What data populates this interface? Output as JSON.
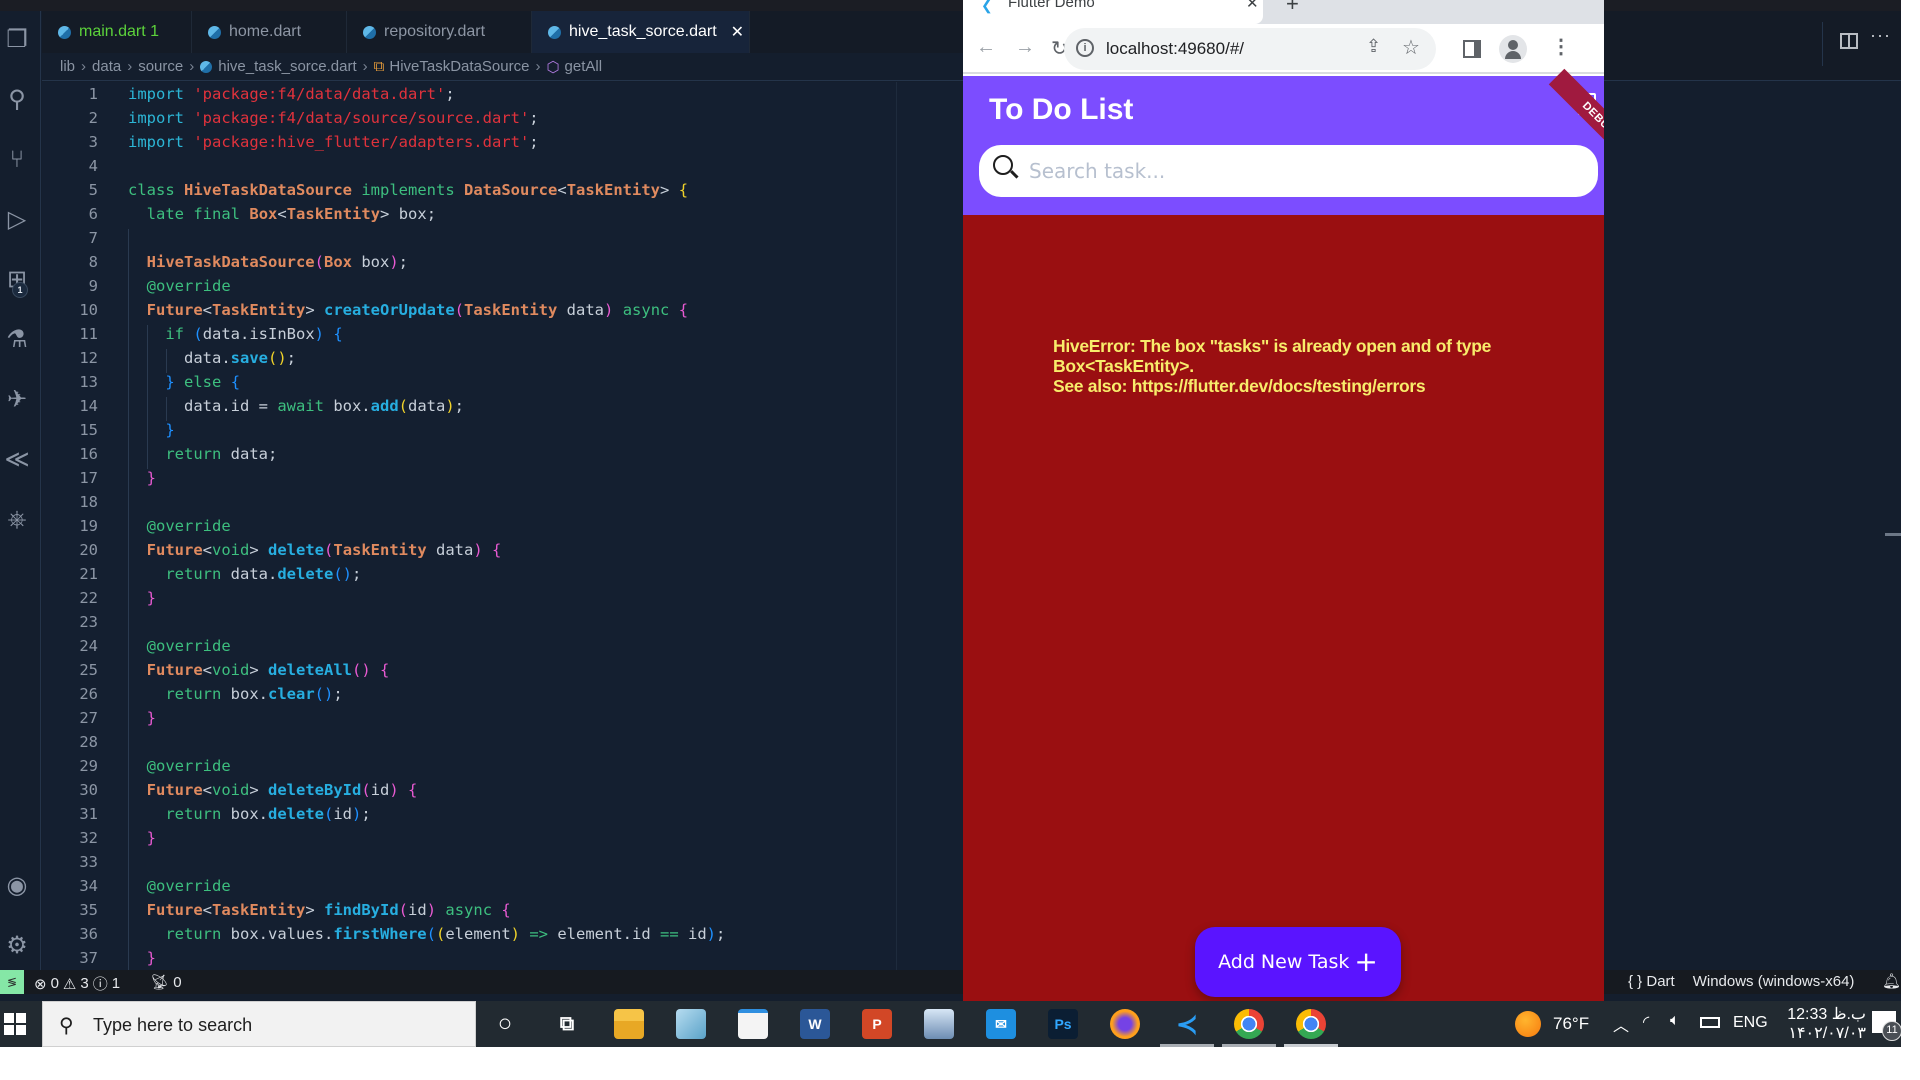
{
  "vscode": {
    "activity_bar": [
      {
        "name": "explorer-icon",
        "glyph": "❐"
      },
      {
        "name": "search-icon",
        "glyph": "⚲"
      },
      {
        "name": "source-control-icon",
        "glyph": "⑂"
      },
      {
        "name": "run-debug-icon",
        "glyph": "▷"
      },
      {
        "name": "extensions-icon",
        "glyph": "⊞",
        "badge": "1"
      },
      {
        "name": "testing-icon",
        "glyph": "⚗"
      },
      {
        "name": "pcc-extension-icon",
        "glyph": "✈"
      },
      {
        "name": "flutter-icon",
        "glyph": "≪"
      },
      {
        "name": "kubernetes-icon",
        "glyph": "⎈"
      },
      {
        "name": "accounts-icon",
        "glyph": "◉"
      },
      {
        "name": "settings-gear-icon",
        "glyph": "⚙"
      }
    ],
    "tabs": [
      {
        "label": "main.dart",
        "suffix": "1",
        "state": "warning"
      },
      {
        "label": "home.dart",
        "state": "normal"
      },
      {
        "label": "repository.dart",
        "state": "normal"
      },
      {
        "label": "hive_task_sorce.dart",
        "state": "active",
        "close": "✕"
      }
    ],
    "breadcrumbs": [
      "lib",
      "data",
      "source",
      "hive_task_sorce.dart",
      "HiveTaskDataSource",
      "getAll"
    ],
    "breadcrumb_separator": "›",
    "editor_actions": {
      "split": "split-editor",
      "more": "···"
    },
    "code_lines": [
      [
        [
          "imp",
          "import"
        ],
        [
          "pl",
          " "
        ],
        [
          "str",
          "'package:f4/data/data.dart'"
        ],
        [
          "pl",
          ";"
        ]
      ],
      [
        [
          "imp",
          "import"
        ],
        [
          "pl",
          " "
        ],
        [
          "str",
          "'package:f4/data/source/source.dart'"
        ],
        [
          "pl",
          ";"
        ]
      ],
      [
        [
          "imp",
          "import"
        ],
        [
          "pl",
          " "
        ],
        [
          "str",
          "'package:hive_flutter/adapters.dart'"
        ],
        [
          "pl",
          ";"
        ]
      ],
      [],
      [
        [
          "kw",
          "class"
        ],
        [
          "pl",
          " "
        ],
        [
          "typ",
          "HiveTaskDataSource"
        ],
        [
          "pl",
          " "
        ],
        [
          "kw",
          "implements"
        ],
        [
          "pl",
          " "
        ],
        [
          "typ",
          "DataSource"
        ],
        [
          "pl",
          "<"
        ],
        [
          "typ",
          "TaskEntity"
        ],
        [
          "pl",
          "> "
        ],
        [
          "p2",
          "{"
        ]
      ],
      [
        [
          "pl",
          "  "
        ],
        [
          "kw",
          "late"
        ],
        [
          "pl",
          " "
        ],
        [
          "kw",
          "final"
        ],
        [
          "pl",
          " "
        ],
        [
          "typ",
          "Box"
        ],
        [
          "pl",
          "<"
        ],
        [
          "typ",
          "TaskEntity"
        ],
        [
          "pl",
          "> box;"
        ]
      ],
      [],
      [
        [
          "pl",
          "  "
        ],
        [
          "typ",
          "HiveTaskDataSource"
        ],
        [
          "p1",
          "("
        ],
        [
          "typ",
          "Box"
        ],
        [
          "pl",
          " box"
        ],
        [
          "p1",
          ")"
        ],
        [
          "pl",
          ";"
        ]
      ],
      [
        [
          "pl",
          "  "
        ],
        [
          "ann",
          "@override"
        ]
      ],
      [
        [
          "pl",
          "  "
        ],
        [
          "typ",
          "Future"
        ],
        [
          "pl",
          "<"
        ],
        [
          "typ",
          "TaskEntity"
        ],
        [
          "pl",
          "> "
        ],
        [
          "fn",
          "createOrUpdate"
        ],
        [
          "p1",
          "("
        ],
        [
          "typ",
          "TaskEntity"
        ],
        [
          "pl",
          " data"
        ],
        [
          "p1",
          ")"
        ],
        [
          "pl",
          " "
        ],
        [
          "kw",
          "async"
        ],
        [
          "pl",
          " "
        ],
        [
          "p1",
          "{"
        ]
      ],
      [
        [
          "pl",
          "    "
        ],
        [
          "kw",
          "if"
        ],
        [
          "pl",
          " "
        ],
        [
          "p3",
          "("
        ],
        [
          "pl",
          "data.isInBox"
        ],
        [
          "p3",
          ")"
        ],
        [
          "pl",
          " "
        ],
        [
          "p3",
          "{"
        ]
      ],
      [
        [
          "pl",
          "      data."
        ],
        [
          "fn",
          "save"
        ],
        [
          "p2",
          "()"
        ],
        [
          "pl",
          ";"
        ]
      ],
      [
        [
          "pl",
          "    "
        ],
        [
          "p3",
          "}"
        ],
        [
          "pl",
          " "
        ],
        [
          "kw",
          "else"
        ],
        [
          "pl",
          " "
        ],
        [
          "p3",
          "{"
        ]
      ],
      [
        [
          "pl",
          "      data.id = "
        ],
        [
          "kw",
          "await"
        ],
        [
          "pl",
          " box."
        ],
        [
          "fn",
          "add"
        ],
        [
          "p2",
          "("
        ],
        [
          "pl",
          "data"
        ],
        [
          "p2",
          ")"
        ],
        [
          "pl",
          ";"
        ]
      ],
      [
        [
          "pl",
          "    "
        ],
        [
          "p3",
          "}"
        ]
      ],
      [
        [
          "pl",
          "    "
        ],
        [
          "kw",
          "return"
        ],
        [
          "pl",
          " data;"
        ]
      ],
      [
        [
          "pl",
          "  "
        ],
        [
          "p1",
          "}"
        ]
      ],
      [],
      [
        [
          "pl",
          "  "
        ],
        [
          "ann",
          "@override"
        ]
      ],
      [
        [
          "pl",
          "  "
        ],
        [
          "typ",
          "Future"
        ],
        [
          "pl",
          "<"
        ],
        [
          "kw",
          "void"
        ],
        [
          "pl",
          "> "
        ],
        [
          "fn",
          "delete"
        ],
        [
          "p1",
          "("
        ],
        [
          "typ",
          "TaskEntity"
        ],
        [
          "pl",
          " data"
        ],
        [
          "p1",
          ")"
        ],
        [
          "pl",
          " "
        ],
        [
          "p1",
          "{"
        ]
      ],
      [
        [
          "pl",
          "    "
        ],
        [
          "kw",
          "return"
        ],
        [
          "pl",
          " data."
        ],
        [
          "fn",
          "delete"
        ],
        [
          "p3",
          "()"
        ],
        [
          "pl",
          ";"
        ]
      ],
      [
        [
          "pl",
          "  "
        ],
        [
          "p1",
          "}"
        ]
      ],
      [],
      [
        [
          "pl",
          "  "
        ],
        [
          "ann",
          "@override"
        ]
      ],
      [
        [
          "pl",
          "  "
        ],
        [
          "typ",
          "Future"
        ],
        [
          "pl",
          "<"
        ],
        [
          "kw",
          "void"
        ],
        [
          "pl",
          "> "
        ],
        [
          "fn",
          "deleteAll"
        ],
        [
          "p1",
          "()"
        ],
        [
          "pl",
          " "
        ],
        [
          "p1",
          "{"
        ]
      ],
      [
        [
          "pl",
          "    "
        ],
        [
          "kw",
          "return"
        ],
        [
          "pl",
          " box."
        ],
        [
          "fn",
          "clear"
        ],
        [
          "p3",
          "()"
        ],
        [
          "pl",
          ";"
        ]
      ],
      [
        [
          "pl",
          "  "
        ],
        [
          "p1",
          "}"
        ]
      ],
      [],
      [
        [
          "pl",
          "  "
        ],
        [
          "ann",
          "@override"
        ]
      ],
      [
        [
          "pl",
          "  "
        ],
        [
          "typ",
          "Future"
        ],
        [
          "pl",
          "<"
        ],
        [
          "kw",
          "void"
        ],
        [
          "pl",
          "> "
        ],
        [
          "fn",
          "deleteById"
        ],
        [
          "p1",
          "("
        ],
        [
          "pl",
          "id"
        ],
        [
          "p1",
          ")"
        ],
        [
          "pl",
          " "
        ],
        [
          "p1",
          "{"
        ]
      ],
      [
        [
          "pl",
          "    "
        ],
        [
          "kw",
          "return"
        ],
        [
          "pl",
          " box."
        ],
        [
          "fn",
          "delete"
        ],
        [
          "p3",
          "("
        ],
        [
          "pl",
          "id"
        ],
        [
          "p3",
          ")"
        ],
        [
          "pl",
          ";"
        ]
      ],
      [
        [
          "pl",
          "  "
        ],
        [
          "p1",
          "}"
        ]
      ],
      [],
      [
        [
          "pl",
          "  "
        ],
        [
          "ann",
          "@override"
        ]
      ],
      [
        [
          "pl",
          "  "
        ],
        [
          "typ",
          "Future"
        ],
        [
          "pl",
          "<"
        ],
        [
          "typ",
          "TaskEntity"
        ],
        [
          "pl",
          "> "
        ],
        [
          "fn",
          "findById"
        ],
        [
          "p1",
          "("
        ],
        [
          "pl",
          "id"
        ],
        [
          "p1",
          ")"
        ],
        [
          "pl",
          " "
        ],
        [
          "kw",
          "async"
        ],
        [
          "pl",
          " "
        ],
        [
          "p1",
          "{"
        ]
      ],
      [
        [
          "pl",
          "    "
        ],
        [
          "kw",
          "return"
        ],
        [
          "pl",
          " box.values."
        ],
        [
          "fn",
          "firstWhere"
        ],
        [
          "p3",
          "("
        ],
        [
          "p2",
          "("
        ],
        [
          "pl",
          "element"
        ],
        [
          "p2",
          ")"
        ],
        [
          "pl",
          " "
        ],
        [
          "kw",
          "=>"
        ],
        [
          "pl",
          " element.id "
        ],
        [
          "kw",
          "=="
        ],
        [
          "pl",
          " id"
        ],
        [
          "p3",
          ")"
        ],
        [
          "pl",
          ";"
        ]
      ],
      [
        [
          "pl",
          "  "
        ],
        [
          "p1",
          "}"
        ]
      ]
    ],
    "status_bar": {
      "errors": "0",
      "warnings": "3",
      "infos": "1",
      "ports": "0",
      "language": "Dart",
      "language_icon": "{ }",
      "device": "Windows (windows-x64)"
    }
  },
  "browser": {
    "tab_title": "Flutter Demo",
    "tab_close": "✕",
    "new_tab": "+",
    "url": "localhost:49680/#/",
    "app": {
      "title": "To Do List",
      "debug_banner": "DEBUG",
      "search_placeholder": "Search task...",
      "search_value": "",
      "error_lines": [
        "HiveError: The box \"tasks\" is already open and of type",
        "Box<TaskEntity>.",
        "See also: https://flutter.dev/docs/testing/errors"
      ],
      "add_button_label": "Add New Task",
      "add_button_icon": "+",
      "colors": {
        "appbar": "#7c4dff",
        "error_bg": "#9a0f11",
        "error_text": "#f8ec6b",
        "button": "#5a14ff"
      }
    }
  },
  "taskbar": {
    "search_placeholder": "Type here to search",
    "apps": [
      {
        "name": "cortana",
        "glyph": "○",
        "running": false
      },
      {
        "name": "task-view",
        "glyph": "⧉",
        "running": false
      },
      {
        "name": "file-explorer",
        "glyph": "",
        "running": false
      },
      {
        "name": "notepad",
        "glyph": "",
        "running": false
      },
      {
        "name": "microsoft-store",
        "glyph": "",
        "running": false
      },
      {
        "name": "word",
        "glyph": "W",
        "running": false
      },
      {
        "name": "powerpoint",
        "glyph": "P",
        "running": false
      },
      {
        "name": "remote-desktop",
        "glyph": "",
        "running": false
      },
      {
        "name": "mail",
        "glyph": "✉",
        "running": false
      },
      {
        "name": "photoshop",
        "glyph": "Ps",
        "running": false
      },
      {
        "name": "firefox",
        "glyph": "",
        "running": false
      },
      {
        "name": "vscode",
        "glyph": "≺",
        "running": true
      },
      {
        "name": "chrome",
        "glyph": "",
        "running": true
      },
      {
        "name": "chrome",
        "glyph": "",
        "running": true,
        "active": true
      }
    ],
    "weather": "76°F",
    "language": "ENG",
    "time": "12:33 ب.ظ",
    "date": "۱۴۰۲/۰۷/۰۳",
    "notification_count": "11"
  }
}
